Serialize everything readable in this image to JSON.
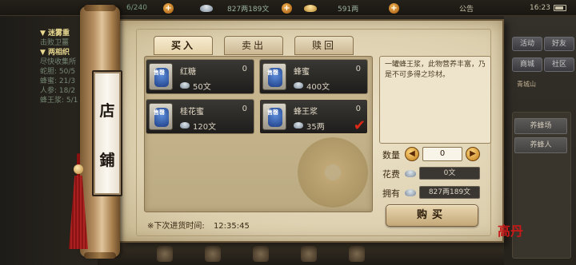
{
  "hud": {
    "stamina": "6/240",
    "silver": "827两189文",
    "gold": "591两",
    "notice": "公告",
    "time": "16:23"
  },
  "quests": {
    "lines": [
      "▼ 迷雾重",
      "击败卫薑",
      "▼ 两相织",
      "尽快收集所",
      "蛇胆: 50/5",
      "蜂蜜: 21/3",
      "人参: 18/2",
      "蜂王浆: 5/1"
    ]
  },
  "side": {
    "buttons": [
      "活动",
      "好友",
      "商城",
      "社区"
    ],
    "location": "青城山",
    "list_items": [
      "养蜂场",
      "养蜂人"
    ]
  },
  "shop": {
    "title_chars": [
      "店",
      "鋪"
    ],
    "tabs": [
      {
        "label": "买入",
        "active": true
      },
      {
        "label": "卖出",
        "active": false
      },
      {
        "label": "赎回",
        "active": false
      }
    ],
    "items": [
      {
        "name": "红糖",
        "qty": "0",
        "price": "50文",
        "tag": "售罄",
        "selected": false
      },
      {
        "name": "蜂蜜",
        "qty": "0",
        "price": "400文",
        "tag": "售罄",
        "selected": false
      },
      {
        "name": "桂花蜜",
        "qty": "0",
        "price": "120文",
        "tag": "售罄",
        "selected": false
      },
      {
        "name": "蜂王浆",
        "qty": "0",
        "price": "35两",
        "tag": "售罄",
        "selected": true
      }
    ],
    "description": "一罐蜂王浆，此物营养丰富，乃是不可多得之珍材。",
    "purchase": {
      "qty_label": "数量",
      "qty_value": "0",
      "cost_label": "花费",
      "cost_value": "0文",
      "owned_label": "拥有",
      "owned_value": "827两189文",
      "buy_label": "购买"
    },
    "restock_label": "※下次进货时间:",
    "restock_time": "12:35:45",
    "seal_text": "高丹"
  }
}
